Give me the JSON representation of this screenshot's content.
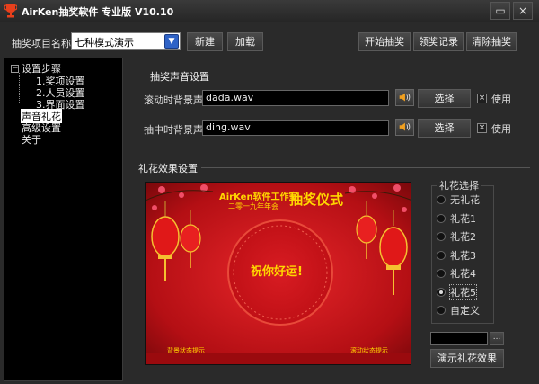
{
  "window": {
    "title": "AirKen抽奖软件 专业版 V10.10",
    "min_symbol": "▭",
    "close_symbol": "×",
    "logo_icon": "trophy-icon"
  },
  "toolbar": {
    "project_label": "抽奖项目名称",
    "project_value": "七种模式演示",
    "new_label": "新建",
    "load_label": "加载",
    "start_label": "开始抽奖",
    "record_label": "领奖记录",
    "clear_label": "清除抽奖"
  },
  "tree": {
    "root": "设置步骤",
    "toggle": "−",
    "children": [
      "1.奖项设置",
      "2.人员设置",
      "3.界面设置"
    ],
    "items": [
      "声音礼花",
      "高级设置",
      "关于"
    ]
  },
  "sound": {
    "group_title": "抽奖声音设置",
    "rolling_label": "滚动时背景声:",
    "rolling_file": "dada.wav",
    "drawing_label": "抽中时背景声:",
    "drawing_file": "ding.wav",
    "select_label": "选择",
    "use_label": "使用",
    "check_mark": "×"
  },
  "fireworks": {
    "group_title": "礼花效果设置",
    "radio_title": "礼花选择",
    "options": [
      "无礼花",
      "礼花1",
      "礼花2",
      "礼花3",
      "礼花4",
      "礼花5",
      "自定义"
    ],
    "selected_index": 5,
    "browse_label": "...",
    "demo_label": "演示礼花效果"
  },
  "preview": {
    "studio": "AirKen软件工作室",
    "year": "二零一九年年会",
    "ceremony": "抽奖仪式",
    "wish": "祝你好运!",
    "left_caption": "背景状态提示",
    "right_caption": "滚动状态提示"
  },
  "colors": {
    "bg": "#2a2a2a",
    "tree_bg": "#000000",
    "preview_red": "#c4141a",
    "preview_gold": "#ffd700"
  }
}
